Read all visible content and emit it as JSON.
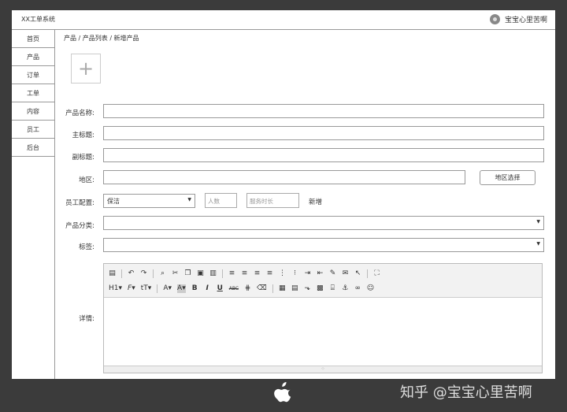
{
  "app": {
    "title": "XX工单系统"
  },
  "user": {
    "name": "宝宝心里苦啊"
  },
  "sidebar": {
    "items": [
      {
        "label": "首页"
      },
      {
        "label": "产品"
      },
      {
        "label": "订单"
      },
      {
        "label": "工单"
      },
      {
        "label": "内容"
      },
      {
        "label": "员工"
      },
      {
        "label": "后台"
      }
    ]
  },
  "breadcrumb": "产品 / 产品列表 / 新增产品",
  "upload": {
    "icon": "plus-icon",
    "symbol": "+"
  },
  "form": {
    "name_label": "产品名称:",
    "main_title_label": "主标题:",
    "sub_title_label": "副标题:",
    "region_label": "地区:",
    "region_button": "地区选择",
    "staff_label": "员工配置:",
    "staff_select": "保洁",
    "people_placeholder": "人数",
    "duration_placeholder": "服务时长",
    "add_link": "新增",
    "category_label": "产品分类:",
    "tags_label": "标签:",
    "details_label": "详情:"
  },
  "toolbar": {
    "row1": [
      "source-icon",
      "undo-icon",
      "redo-icon",
      "find-icon",
      "cut-icon",
      "copy-icon",
      "paste-icon",
      "paste-text-icon",
      "align-left-icon",
      "align-center-icon",
      "align-right-icon",
      "justify-icon",
      "ordered-list-icon",
      "unordered-list-icon",
      "indent-icon",
      "outdent-icon",
      "clear-icon",
      "template-icon",
      "select-icon",
      "fullscreen-icon"
    ],
    "row2_labels": {
      "heading": "H1",
      "font": "F",
      "size": "tT",
      "color": "A",
      "bgcolor": "A",
      "bold": "B",
      "italic": "I",
      "underline": "U",
      "strike": "ABC"
    }
  },
  "watermark": "知乎 @宝宝心里苦啊"
}
